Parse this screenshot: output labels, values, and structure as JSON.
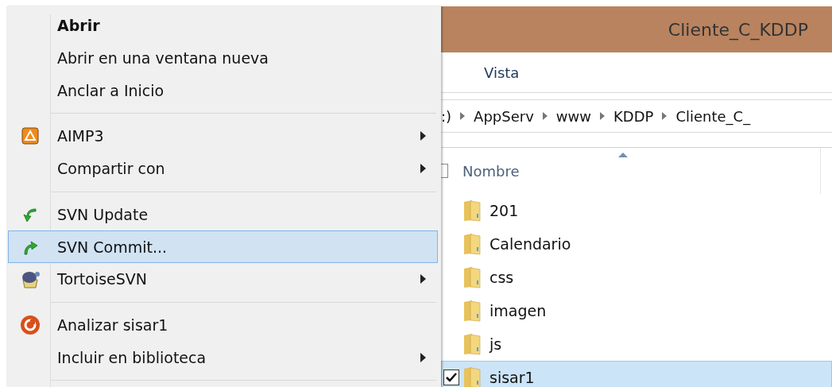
{
  "context_menu": {
    "items": [
      {
        "kind": "item",
        "label": "Abrir",
        "bold": true,
        "submenu": false,
        "selected": false
      },
      {
        "kind": "item",
        "label": "Abrir en una ventana nueva",
        "bold": false,
        "submenu": false,
        "selected": false
      },
      {
        "kind": "item",
        "label": "Anclar a Inicio",
        "bold": false,
        "submenu": false,
        "selected": false
      },
      {
        "kind": "separator"
      },
      {
        "kind": "item",
        "label": "AIMP3",
        "bold": false,
        "submenu": true,
        "selected": false
      },
      {
        "kind": "item",
        "label": "Compartir con",
        "bold": false,
        "submenu": true,
        "selected": false
      },
      {
        "kind": "separator"
      },
      {
        "kind": "item",
        "label": "SVN Update",
        "bold": false,
        "submenu": false,
        "selected": false
      },
      {
        "kind": "item",
        "label": "SVN Commit...",
        "bold": false,
        "submenu": false,
        "selected": true
      },
      {
        "kind": "item",
        "label": "TortoiseSVN",
        "bold": false,
        "submenu": true,
        "selected": false
      },
      {
        "kind": "separator"
      },
      {
        "kind": "item",
        "label": "Analizar sisar1",
        "bold": false,
        "submenu": false,
        "selected": false
      },
      {
        "kind": "item",
        "label": "Incluir en biblioteca",
        "bold": false,
        "submenu": true,
        "selected": false
      },
      {
        "kind": "separator"
      }
    ]
  },
  "window": {
    "title": "Cliente_C_KDDP"
  },
  "ribbon": {
    "tabs": [
      "Vista"
    ]
  },
  "address_bar": {
    "parts": [
      ":)",
      "AppServ",
      "www",
      "KDDP",
      "Cliente_C_"
    ]
  },
  "file_list": {
    "select_all": {
      "checked": false
    },
    "columns": [
      {
        "label": "Nombre",
        "sorted": true
      }
    ],
    "rows": [
      {
        "name": "201",
        "selected": false,
        "checked": false
      },
      {
        "name": "Calendario",
        "selected": false,
        "checked": false
      },
      {
        "name": "css",
        "selected": false,
        "checked": false
      },
      {
        "name": "imagen",
        "selected": false,
        "checked": false
      },
      {
        "name": "js",
        "selected": false,
        "checked": false
      },
      {
        "name": "sisar1",
        "selected": true,
        "checked": true
      }
    ]
  }
}
